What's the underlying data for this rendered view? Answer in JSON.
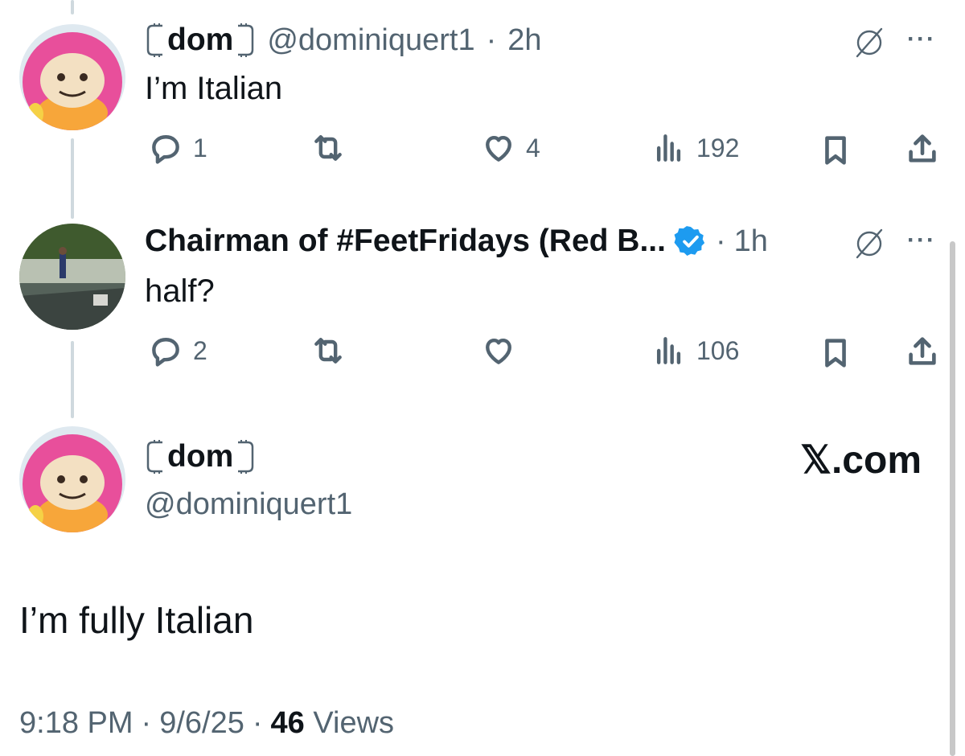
{
  "tweets": [
    {
      "display_name": "dom",
      "handle": "@dominiquert1",
      "time": "2h",
      "text": "I’m Italian",
      "replies": "1",
      "likes": "4",
      "views": "192"
    },
    {
      "display_name": "Chairman of #FeetFridays (Red B...",
      "time": "1h",
      "text": "half?",
      "replies": "2",
      "likes": "",
      "views": "106"
    }
  ],
  "main": {
    "display_name": "dom",
    "handle": "@dominiquert1",
    "brand": "𝕏.com",
    "text": "I’m fully Italian",
    "time": "9:18 PM",
    "date": "9/6/25",
    "views_count": "46",
    "views_label": "Views",
    "separator": "·"
  },
  "colors": {
    "accent": "#1d9bf0",
    "muted": "#536471",
    "text": "#0f1419",
    "avatar_pink": "#e84f9b"
  },
  "icons": [
    "reply-icon",
    "repost-icon",
    "like-icon",
    "views-icon",
    "bookmark-icon",
    "share-icon",
    "grok-icon",
    "more-icon",
    "verified-badge-icon"
  ]
}
